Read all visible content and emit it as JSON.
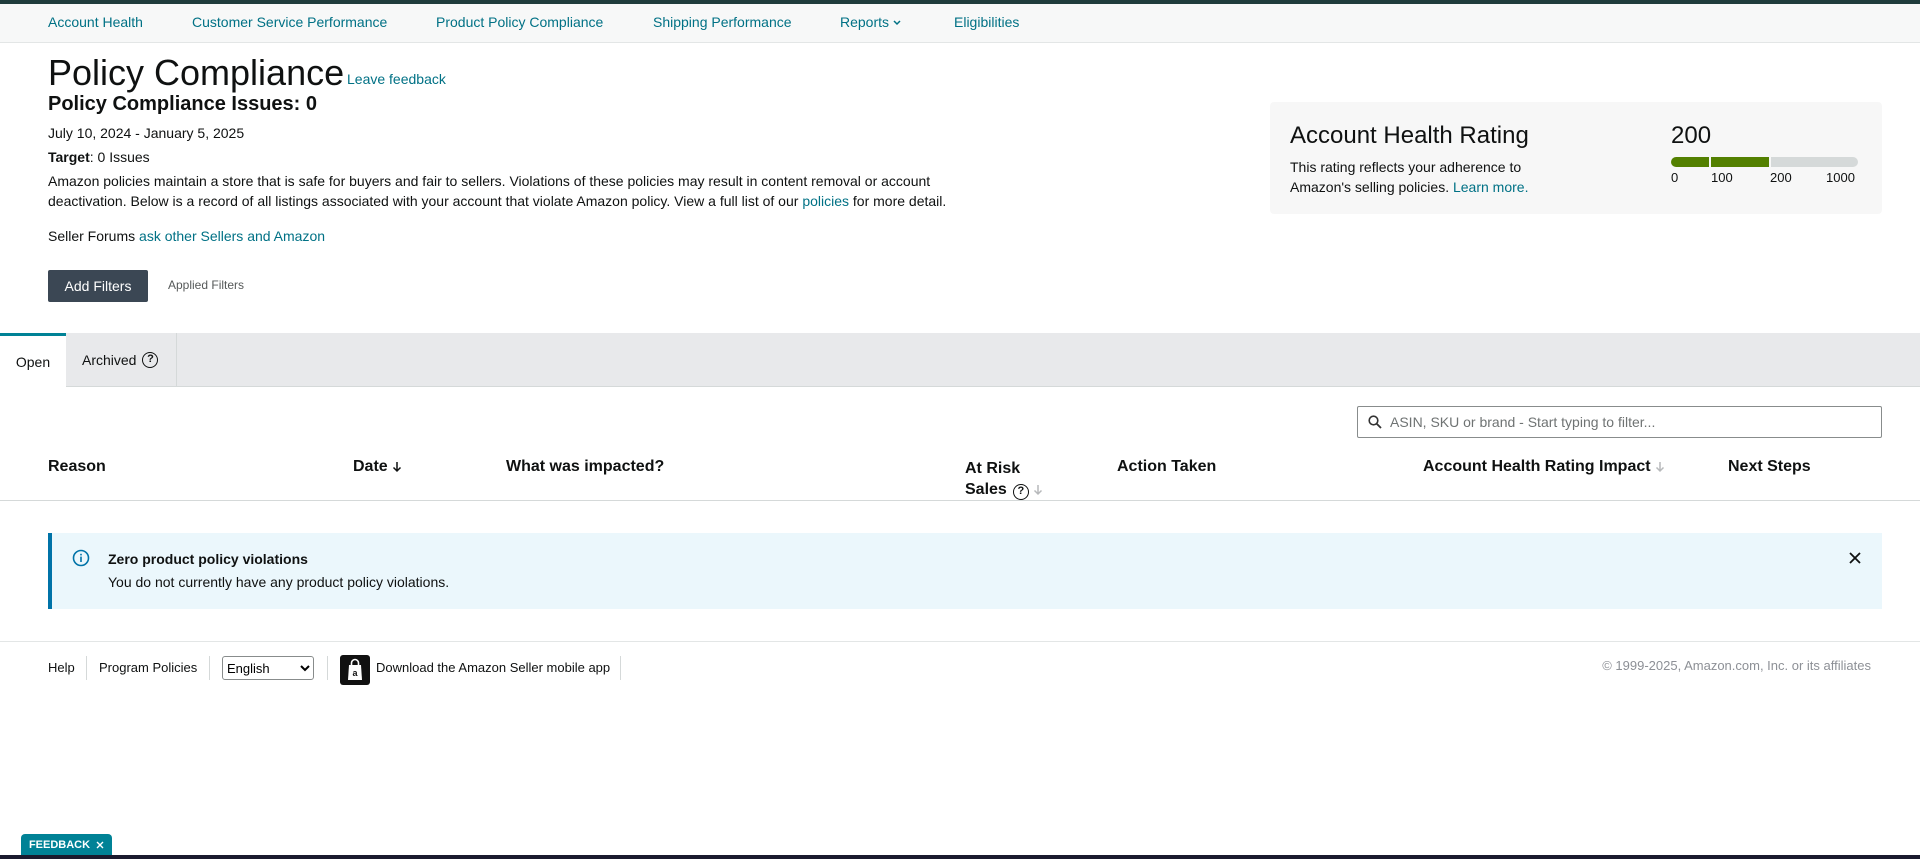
{
  "nav": {
    "items": [
      {
        "label": "Account Health"
      },
      {
        "label": "Customer Service Performance"
      },
      {
        "label": "Product Policy Compliance"
      },
      {
        "label": "Shipping Performance"
      },
      {
        "label": "Reports"
      },
      {
        "label": "Eligibilities"
      }
    ]
  },
  "header": {
    "title": "Policy Compliance",
    "leave_feedback": "Leave feedback",
    "issues_title": "Policy Compliance Issues: 0",
    "date_range": "July 10, 2024 - January 5, 2025",
    "target_label": "Target",
    "target_value": ": 0 Issues",
    "description_pre": "Amazon policies maintain a store that is safe for buyers and fair to sellers. Violations of these policies may result in content removal or account deactivation. Below is a record of all listings associated with your account that violate Amazon policy. View a full list of our ",
    "description_link": "policies",
    "description_post": " for more detail.",
    "forums_label": "Seller Forums ",
    "forums_link": "ask other Sellers and Amazon"
  },
  "filters": {
    "add_label": "Add Filters",
    "applied_label": "Applied Filters"
  },
  "ahr": {
    "title": "Account Health Rating",
    "desc": "This rating reflects your adherence to Amazon's selling policies.",
    "learn_more": "Learn more.",
    "score": "200",
    "score_value": 200,
    "ticks": [
      "0",
      "100",
      "200",
      "1000"
    ],
    "colors": {
      "filled": "#538000",
      "empty": "#d5d9d9"
    }
  },
  "tabs": {
    "open": "Open",
    "archived": "Archived"
  },
  "search": {
    "placeholder": "ASIN, SKU or brand - Start typing to filter..."
  },
  "table": {
    "columns": {
      "reason": "Reason",
      "date": "Date",
      "impacted": "What was impacted?",
      "at_risk_1": "At Risk",
      "at_risk_2": "Sales",
      "action": "Action Taken",
      "ahr_impact": "Account Health Rating Impact",
      "next_steps": "Next Steps"
    }
  },
  "alert": {
    "title": "Zero product policy violations",
    "text": "You do not currently have any product policy violations."
  },
  "footer": {
    "help": "Help",
    "program_policies": "Program Policies",
    "language": "English",
    "app_download": "Download the Amazon Seller mobile app",
    "copyright": "© 1999-2025, Amazon.com, Inc. or its affiliates"
  },
  "feedback_tab": {
    "label": "FEEDBACK"
  }
}
